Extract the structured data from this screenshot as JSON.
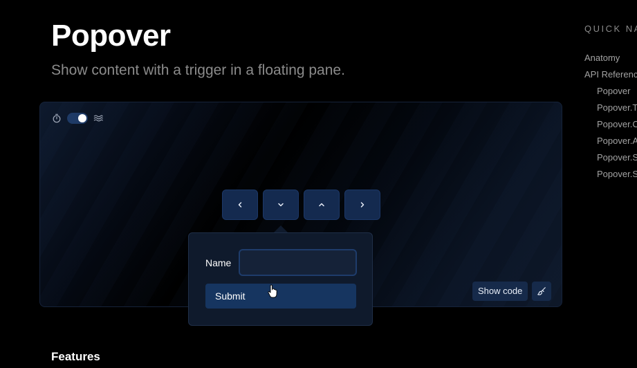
{
  "header": {
    "title": "Popover",
    "subtitle": "Show content with a trigger in a floating pane."
  },
  "demo": {
    "controls": {
      "timer_icon": "timer-icon",
      "toggle_on": true,
      "waves_icon": "waves-icon"
    },
    "triggers": [
      {
        "icon": "chevron-left-icon"
      },
      {
        "icon": "chevron-down-icon"
      },
      {
        "icon": "chevron-up-icon"
      },
      {
        "icon": "chevron-right-icon"
      }
    ],
    "show_code_label": "Show code",
    "brush_icon": "paintbrush-icon"
  },
  "popover": {
    "name_label": "Name",
    "name_value": "",
    "submit_label": "Submit"
  },
  "section": {
    "features_heading": "Features"
  },
  "quick_nav": {
    "title": "QUICK NAV",
    "items": [
      {
        "label": "Anatomy",
        "level": 0
      },
      {
        "label": "API Referenc",
        "level": 0
      },
      {
        "label": "Popover",
        "level": 1
      },
      {
        "label": "Popover.T",
        "level": 1
      },
      {
        "label": "Popover.C",
        "level": 1
      },
      {
        "label": "Popover.A",
        "level": 1
      },
      {
        "label": "Popover.S",
        "level": 1
      },
      {
        "label": "Popover.S",
        "level": 1
      }
    ]
  },
  "colors": {
    "background": "#000000",
    "accent": "#163560",
    "trigger_bg": "#142a4f",
    "muted_text": "#8b8b8b"
  }
}
